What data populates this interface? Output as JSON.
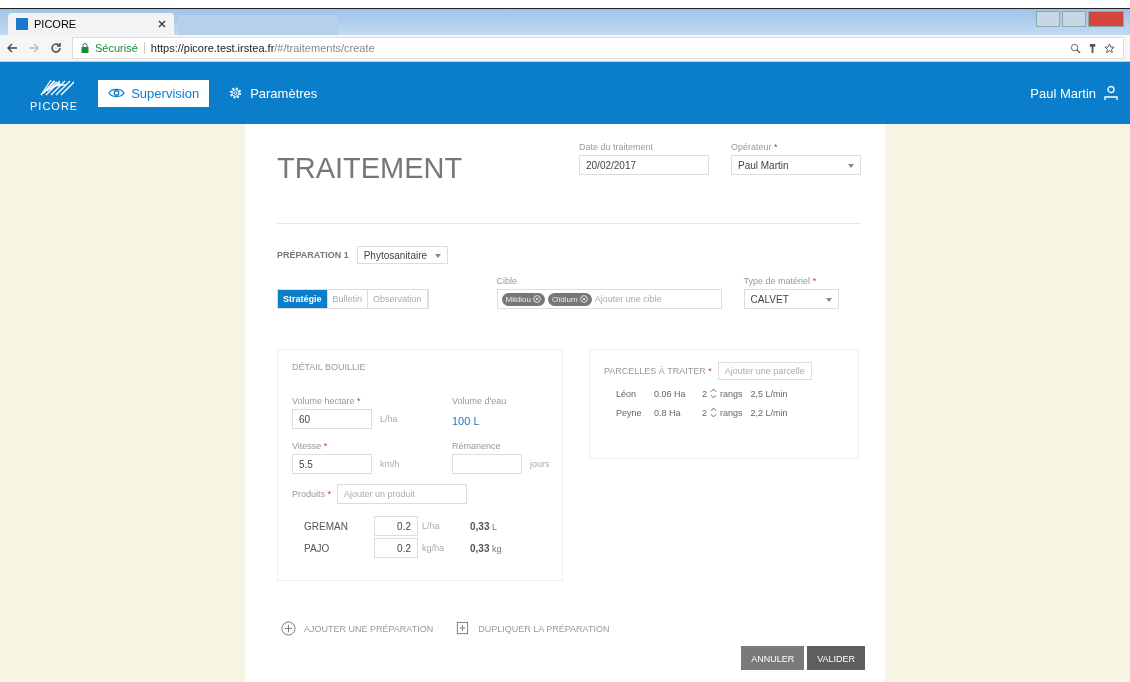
{
  "browser": {
    "tab_title": "PICORE",
    "secure_label": "Sécurisé",
    "url_host": "https://picore.test.irstea.fr",
    "url_path": "/#/traitements/create"
  },
  "header": {
    "logo_text": "PICORE",
    "nav": [
      {
        "label": "Supervision",
        "kind": "eye",
        "selected": true
      },
      {
        "label": "Paramètres",
        "kind": "gear",
        "selected": false
      }
    ],
    "user": "Paul Martin"
  },
  "title": "TRAITEMENT",
  "date_field": {
    "label": "Date du traitement",
    "value": "20/02/2017"
  },
  "operator_field": {
    "label": "Opérateur",
    "required_mark": "*",
    "value": "Paul Martin"
  },
  "preparation": {
    "label": "PRÉPARATION 1",
    "type": "Phytosanitaire",
    "tabs": [
      {
        "label": "Stratégie",
        "selected": true
      },
      {
        "label": "Bulletin",
        "selected": false
      },
      {
        "label": "Observation",
        "selected": false
      }
    ],
    "target": {
      "label": "Cible",
      "tags": [
        "Mildiou",
        "Oïdium"
      ],
      "placeholder": "Ajouter une cible"
    },
    "equipment": {
      "label": "Type de matériel",
      "required_mark": "*",
      "value": "CALVET"
    }
  },
  "detail": {
    "title": "DÉTAIL BOUILLIE",
    "volume_hectare": {
      "label": "Volume hectare",
      "required_mark": "*",
      "value": "60",
      "unit": "L/ha"
    },
    "volume_eau": {
      "label": "Volume d'eau",
      "value": "100 L"
    },
    "vitesse": {
      "label": "Vitesse",
      "required_mark": "*",
      "value": "5.5",
      "unit": "km/h"
    },
    "remanence": {
      "label": "Rémanence",
      "unit": "jours"
    },
    "products_label": "Produits",
    "products_required_mark": "*",
    "products_placeholder": "Ajouter un produit",
    "products": [
      {
        "name": "GREMAN",
        "dose": "0.2",
        "unit": "L/ha",
        "total": "0,33",
        "total_unit": "L"
      },
      {
        "name": "PAJO",
        "dose": "0.2",
        "unit": "kg/ha",
        "total": "0,33",
        "total_unit": "kg"
      }
    ]
  },
  "parcels": {
    "title": "PARCELLES À TRAITER",
    "required_mark": "*",
    "placeholder": "Ajouter une parcelle",
    "rows": [
      {
        "name": "Léon",
        "area": "0.06 Ha",
        "rows": "2",
        "rows_label": "rangs",
        "flow": "2,5 L/min"
      },
      {
        "name": "Peyne",
        "area": "0.8 Ha",
        "rows": "2",
        "rows_label": "rangs",
        "flow": "2,2 L/min"
      }
    ]
  },
  "actions": [
    {
      "label": "AJOUTER UNE PRÉPARATION",
      "kind": "add"
    },
    {
      "label": "DUPLIQUER LA PRÉPARATION",
      "kind": "duplicate"
    }
  ],
  "buttons": [
    "ANNULER",
    "VALIDER"
  ]
}
